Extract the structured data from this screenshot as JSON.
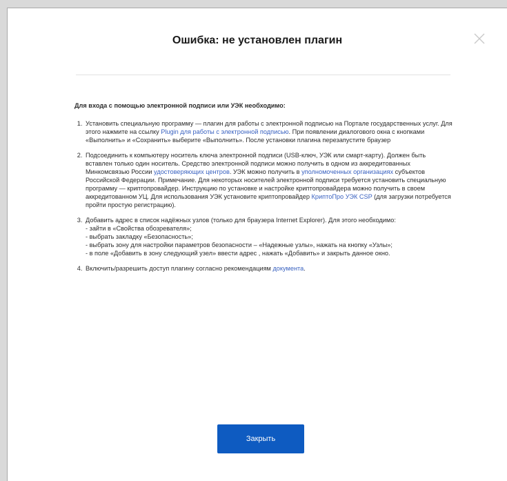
{
  "dialog": {
    "title": "Ошибка: не установлен плагин",
    "close_icon": "close-icon",
    "intro": "Для входа с помощью электронной подписи или УЭК необходимо:",
    "item1": {
      "text_a": "Установить специальную программу — плагин для работы с электронной подписью на Портале государственных услуг. Для этого нажмите на ссылку ",
      "link1": "Plugin для работы с электронной подписью",
      "text_b": ". При появлении диалогового окна с кнопками «Выполнить» и «Сохранить» выберите «Выполнить». После установки плагина перезапустите браузер"
    },
    "item2": {
      "text_a": "Подсоединить к компьютеру носитель ключа электронной подписи (USB-ключ, УЭК или смарт-карту). Должен быть вставлен только один носитель. Средство электронной подписи можно получить в одном из аккредитованных Минкомсвязью России ",
      "link1": "удостоверяющих центров",
      "text_b": ". УЭК можно получить в ",
      "link2": "уполномоченных организациях",
      "text_c": " субъектов Российской Федерации. Примечание. Для некоторых носителей электронной подписи требуется установить специальную программу — криптопровайдер. Инструкцию по установке и настройке криптопровайдера можно получить в своем аккредитованном УЦ. Для использования УЭК установите криптопровайдер ",
      "link3": "КриптоПро УЭК CSP",
      "text_d": " (для загрузки потребуется пройти простую регистрацию)."
    },
    "item3": {
      "line1": "Добавить адрес в список надёжных узлов (только для браузера Internet Explorer). Для этого необходимо:",
      "line2": "- зайти в «Свойства обозревателя»;",
      "line3": "- выбрать закладку «Безопасность»;",
      "line4": "- выбрать зону для настройки параметров безопасности – «Надежные узлы», нажать на кнопку «Узлы»;",
      "line5": "- в поле «Добавить в зону следующий узел» ввести адрес , нажать «Добавить» и закрыть данное окно."
    },
    "item4": {
      "text_a": "Включить/разрешить доступ плагину согласно рекомендациям ",
      "link1": "документа",
      "text_b": "."
    },
    "close_button": "Закрыть"
  }
}
